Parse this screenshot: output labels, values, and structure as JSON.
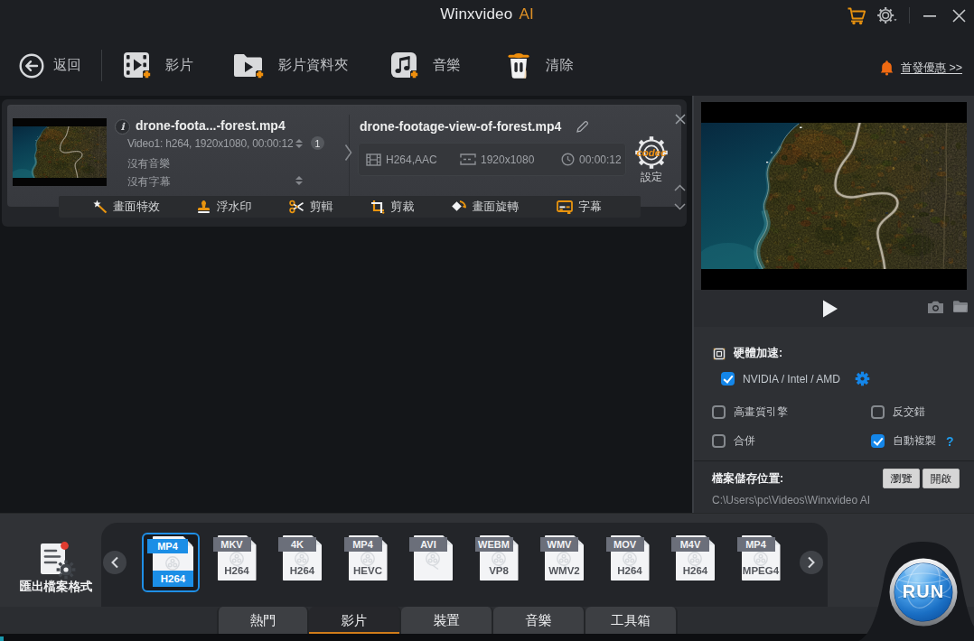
{
  "colors": {
    "accent_orange": "#e8920f",
    "accent_blue": "#1486e9",
    "selected_blue": "#1b8ee6",
    "tab_underline": "#cf7c1a"
  },
  "titlebar": {
    "title": "Winxvideo",
    "title_suffix": "AI",
    "cart_icon": "shopping-cart",
    "settings_icon": "gear",
    "minimize_icon": "minus",
    "close_icon": "x"
  },
  "toolbar": {
    "back": "返回",
    "video": "影片",
    "video_folder": "影片資料夾",
    "music": "音樂",
    "clear": "清除",
    "promo": "首發優惠 >>"
  },
  "file_card": {
    "source_name": "drone-foota...-forest.mp4",
    "video_track": "Video1: h264, 1920x1080, 00:00:12",
    "track_badge": "1",
    "audio_track": "沒有音樂",
    "subtitle_track": "沒有字幕",
    "output_name": "drone-footage-view-of-forest.mp4",
    "codec": "H264,AAC",
    "resolution": "1920x1080",
    "duration": "00:00:12",
    "codec_badge": "codec",
    "settings_label": "設定",
    "tools": [
      "畫面特效",
      "浮水印",
      "剪輯",
      "剪裁",
      "畫面旋轉",
      "字幕"
    ]
  },
  "options": {
    "hardware_accel": "硬體加速:",
    "gpu": "NVIDIA / Intel / AMD",
    "gpu_checked": true,
    "hq_engine": "高畫質引擎",
    "hq_checked": false,
    "deinterlace": "反交錯",
    "deinterlace_checked": false,
    "merge": "合併",
    "merge_checked": false,
    "auto_copy": "自動複製",
    "auto_copy_checked": true,
    "help": "?"
  },
  "save": {
    "label": "檔案儲存位置:",
    "path": "C:\\Users\\pc\\Videos\\Winxvideo AI",
    "browse": "瀏覽",
    "open": "開啟"
  },
  "export": {
    "label": "匯出檔案格式",
    "run": "RUN",
    "formats": [
      {
        "container": "MP4",
        "codec": "H264",
        "selected": true
      },
      {
        "container": "MKV",
        "codec": "H264",
        "selected": false
      },
      {
        "container": "4K",
        "codec": "H264",
        "selected": false
      },
      {
        "container": "MP4",
        "codec": "HEVC",
        "selected": false
      },
      {
        "container": "AVI",
        "codec": "",
        "selected": false
      },
      {
        "container": "WEBM",
        "codec": "VP8",
        "selected": false
      },
      {
        "container": "WMV",
        "codec": "WMV2",
        "selected": false
      },
      {
        "container": "MOV",
        "codec": "H264",
        "selected": false
      },
      {
        "container": "M4V",
        "codec": "H264",
        "selected": false
      },
      {
        "container": "MP4",
        "codec": "MPEG4",
        "selected": false
      }
    ]
  },
  "tabs": [
    {
      "label": "熱門",
      "selected": false
    },
    {
      "label": "影片",
      "selected": true
    },
    {
      "label": "裝置",
      "selected": false
    },
    {
      "label": "音樂",
      "selected": false
    },
    {
      "label": "工具箱",
      "selected": false
    }
  ]
}
